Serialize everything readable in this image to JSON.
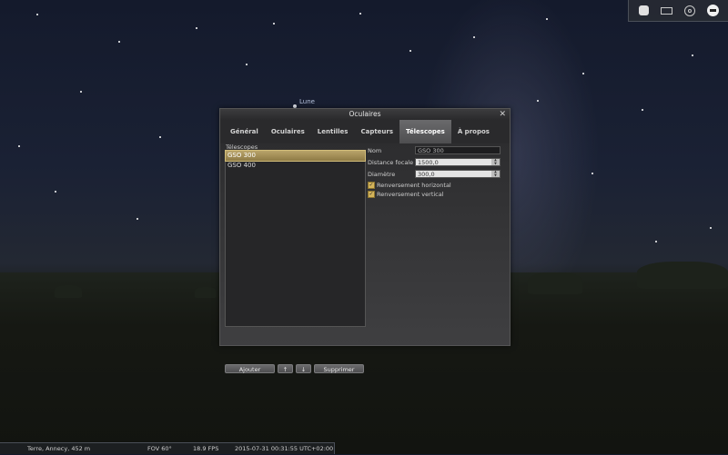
{
  "sky": {
    "moon_label": "Lune"
  },
  "toolbar": {
    "items": [
      {
        "name": "fullscreen"
      },
      {
        "name": "window"
      },
      {
        "name": "target"
      },
      {
        "name": "exit"
      }
    ]
  },
  "dialog": {
    "title": "Oculaires",
    "close": "✕",
    "tabs": [
      "Général",
      "Oculaires",
      "Lentilles",
      "Capteurs",
      "Télescopes",
      "À propos"
    ],
    "active_tab": "Télescopes",
    "list_label": "Télescopes",
    "list_items": [
      "GSO 300",
      "GSO 400"
    ],
    "selected_item": "GSO 300",
    "buttons": {
      "add": "Ajouter",
      "up": "↑",
      "down": "↓",
      "delete": "Supprimer"
    },
    "form": {
      "name_label": "Nom",
      "name_value": "GSO 300",
      "focal_label": "Distance focale",
      "focal_value": "1500,0",
      "diameter_label": "Diamètre",
      "diameter_value": "300,0",
      "flip_h_label": "Renversement horizontal",
      "flip_h_checked": true,
      "flip_v_label": "Renversement vertical",
      "flip_v_checked": true
    }
  },
  "status": {
    "location": "Terre, Annecy, 452 m",
    "fov": "FOV 60°",
    "fps": "18.9 FPS",
    "datetime": "2015-07-31   00:31:55 UTC+02:00"
  }
}
